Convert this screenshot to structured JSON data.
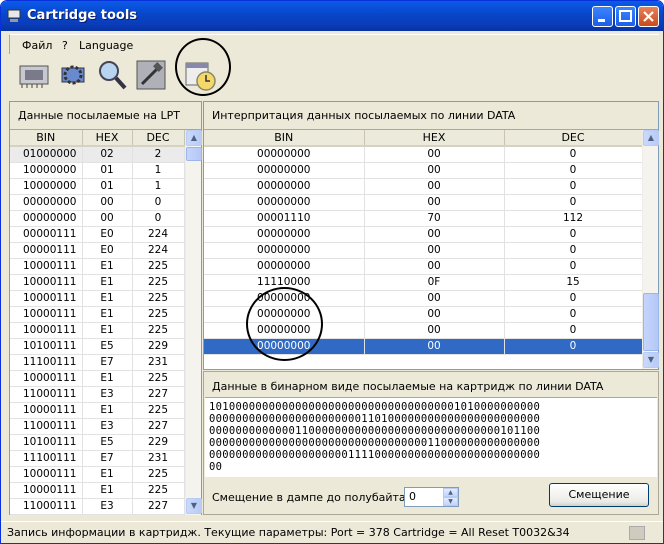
{
  "window": {
    "title": "Cartridge tools"
  },
  "menu": {
    "items": [
      "Файл",
      "?",
      "Language"
    ]
  },
  "toolbar": {
    "tools": [
      "chip-read-icon",
      "chip-settings-icon",
      "magnifier-icon",
      "hammer-icon",
      "calendar-clock-icon"
    ]
  },
  "lpt_panel": {
    "title": "Данные посылаемые на LPT",
    "columns": [
      "BIN",
      "HEX",
      "DEC"
    ],
    "rows": [
      [
        "01000000",
        "02",
        "2"
      ],
      [
        "10000000",
        "01",
        "1"
      ],
      [
        "10000000",
        "01",
        "1"
      ],
      [
        "00000000",
        "00",
        "0"
      ],
      [
        "00000000",
        "00",
        "0"
      ],
      [
        "00000111",
        "E0",
        "224"
      ],
      [
        "00000111",
        "E0",
        "224"
      ],
      [
        "10000111",
        "E1",
        "225"
      ],
      [
        "10000111",
        "E1",
        "225"
      ],
      [
        "10000111",
        "E1",
        "225"
      ],
      [
        "10000111",
        "E1",
        "225"
      ],
      [
        "10000111",
        "E1",
        "225"
      ],
      [
        "10100111",
        "E5",
        "229"
      ],
      [
        "11100111",
        "E7",
        "231"
      ],
      [
        "10000111",
        "E1",
        "225"
      ],
      [
        "11000111",
        "E3",
        "227"
      ],
      [
        "10000111",
        "E1",
        "225"
      ],
      [
        "11000111",
        "E3",
        "227"
      ],
      [
        "10100111",
        "E5",
        "229"
      ],
      [
        "11100111",
        "E7",
        "231"
      ],
      [
        "10000111",
        "E1",
        "225"
      ],
      [
        "10000111",
        "E1",
        "225"
      ],
      [
        "11000111",
        "E3",
        "227"
      ]
    ]
  },
  "data_panel": {
    "title": "Интерпритация данных посылаемых по линии DATA",
    "columns": [
      "BIN",
      "HEX",
      "DEC"
    ],
    "rows": [
      [
        "00000000",
        "00",
        "0"
      ],
      [
        "00000000",
        "00",
        "0"
      ],
      [
        "00000000",
        "00",
        "0"
      ],
      [
        "00000000",
        "00",
        "0"
      ],
      [
        "00001110",
        "70",
        "112"
      ],
      [
        "00000000",
        "00",
        "0"
      ],
      [
        "00000000",
        "00",
        "0"
      ],
      [
        "00000000",
        "00",
        "0"
      ],
      [
        "11110000",
        "0F",
        "15"
      ],
      [
        "00000000",
        "00",
        "0"
      ],
      [
        "00000000",
        "00",
        "0"
      ],
      [
        "00000000",
        "00",
        "0"
      ],
      [
        "00000000",
        "00",
        "0"
      ]
    ]
  },
  "binary_panel": {
    "title": "Данные в бинарном виде посылаемые на картридж по линии DATA",
    "lines": [
      "10100000000000000000000000000000000001010000000000",
      "00000000000000000000000110100000000000000000000000",
      "00000000000001100000000000000000000000000000101100",
      "00000000000000000000000000000000011000000000000000",
      "00000000000000000000011110000000000000000000000000",
      "00"
    ],
    "offset_label": "Смещение в дампе до полубайта",
    "offset_value": "0",
    "offset_button": "Смещение"
  },
  "status": {
    "text": "Запись информации в картридж. Текущие параметры: Port = 378 Cartridge = All Reset T0032&34"
  }
}
